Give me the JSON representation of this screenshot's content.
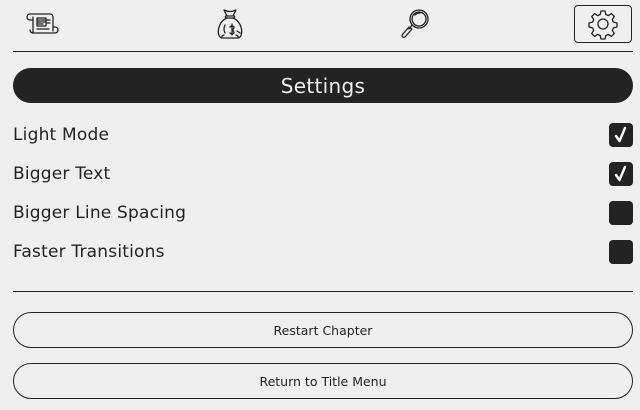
{
  "toolbar": {
    "items": [
      {
        "icon": "scroll-icon",
        "active": false
      },
      {
        "icon": "money-bag-icon",
        "active": false
      },
      {
        "icon": "magnifying-glass-icon",
        "active": false
      },
      {
        "icon": "gear-icon",
        "active": true
      }
    ]
  },
  "settings": {
    "title": "Settings",
    "options": [
      {
        "label": "Light Mode",
        "checked": true
      },
      {
        "label": "Bigger Text",
        "checked": true
      },
      {
        "label": "Bigger Line Spacing",
        "checked": false
      },
      {
        "label": "Faster Transitions",
        "checked": false
      }
    ]
  },
  "actions": {
    "restart_label": "Restart Chapter",
    "title_menu_label": "Return to Title Menu"
  },
  "colors": {
    "background": "#efefef",
    "ink": "#232323"
  }
}
